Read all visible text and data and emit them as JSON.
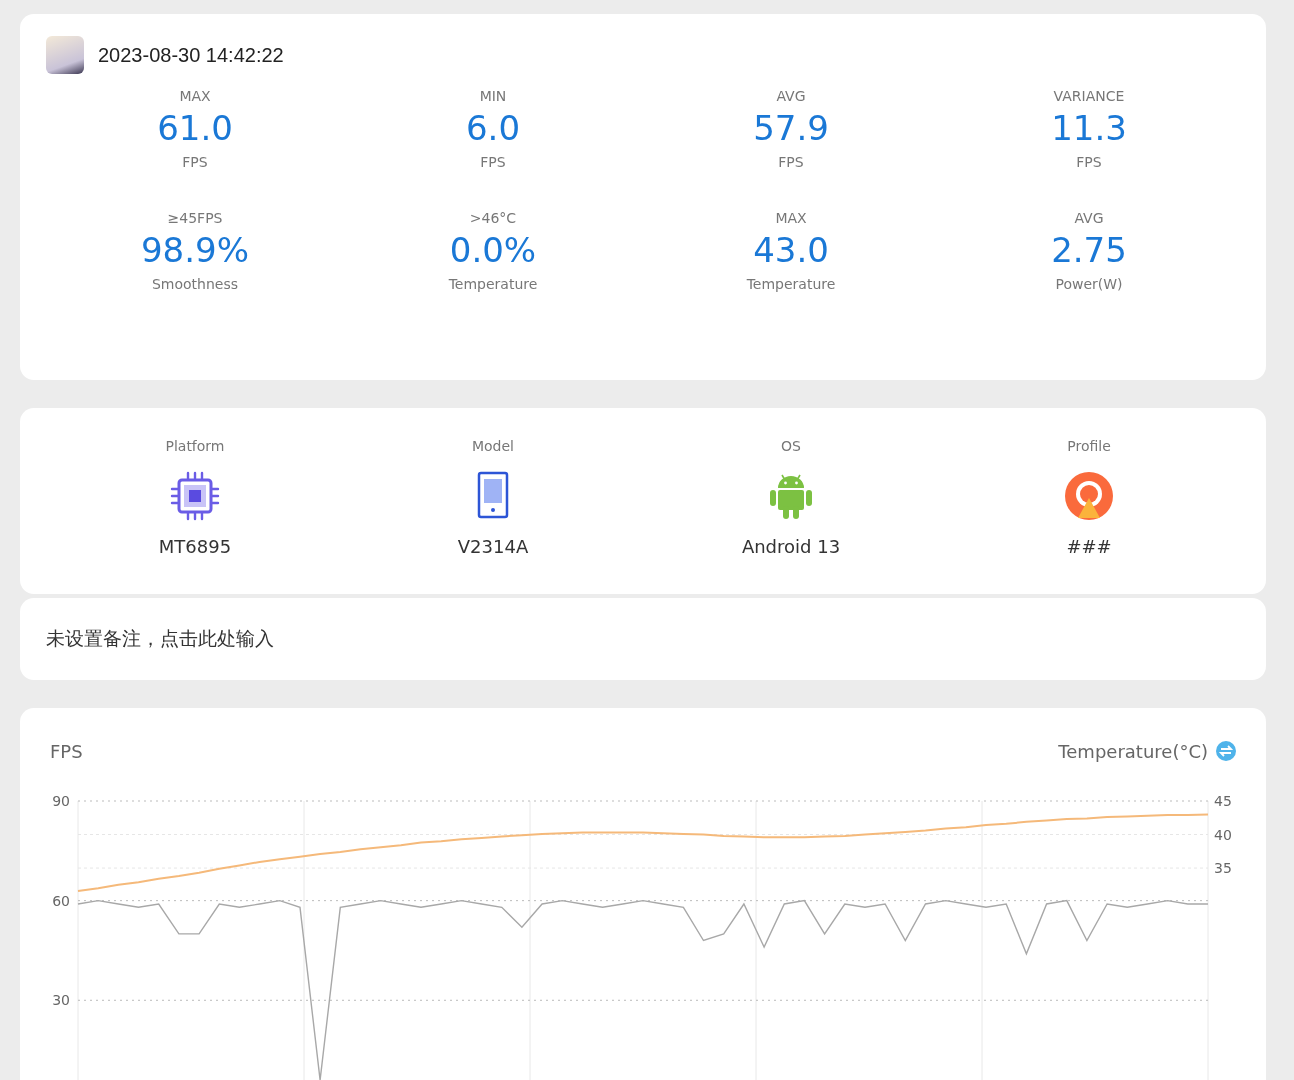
{
  "header": {
    "timestamp": "2023-08-30 14:42:22"
  },
  "stats": [
    {
      "label": "MAX",
      "value": "61.0",
      "unit": "FPS"
    },
    {
      "label": "MIN",
      "value": "6.0",
      "unit": "FPS"
    },
    {
      "label": "AVG",
      "value": "57.9",
      "unit": "FPS"
    },
    {
      "label": "VARIANCE",
      "value": "11.3",
      "unit": "FPS"
    },
    {
      "label": "≥45FPS",
      "value": "98.9%",
      "unit": "Smoothness"
    },
    {
      "label": ">46°C",
      "value": "0.0%",
      "unit": "Temperature"
    },
    {
      "label": "MAX",
      "value": "43.0",
      "unit": "Temperature"
    },
    {
      "label": "AVG",
      "value": "2.75",
      "unit": "Power(W)"
    }
  ],
  "device": [
    {
      "kind": "chip",
      "label": "Platform",
      "value": "MT6895"
    },
    {
      "kind": "phone",
      "label": "Model",
      "value": "V2314A"
    },
    {
      "kind": "android",
      "label": "OS",
      "value": "Android 13"
    },
    {
      "kind": "profile",
      "label": "Profile",
      "value": "###"
    }
  ],
  "note": {
    "text": "未设置备注，点击此处输入"
  },
  "chart": {
    "right_title": "Temperature(°C)",
    "chart_data": {
      "type": "line",
      "ylabel": "FPS",
      "ylim": [
        6,
        90
      ],
      "yticks": [
        90,
        60,
        30
      ],
      "y2lim": [
        3.4,
        45
      ],
      "y2ticks": [
        45,
        40,
        35
      ],
      "grid": true,
      "series": [
        {
          "color": "#a8a8a8",
          "values": [
            59,
            60,
            59,
            58,
            59,
            50,
            50,
            59,
            58,
            59,
            60,
            58,
            6,
            58,
            59,
            60,
            59,
            58,
            59,
            60,
            59,
            58,
            52,
            59,
            60,
            59,
            58,
            59,
            60,
            59,
            58,
            48,
            50,
            59,
            46,
            59,
            60,
            50,
            59,
            58,
            59,
            48,
            59,
            60,
            59,
            58,
            59,
            44,
            59,
            60,
            48,
            59,
            58,
            59,
            60,
            59,
            59
          ]
        },
        {
          "axis": "y2",
          "color": "#f5b97a",
          "values": [
            31.6,
            32.0,
            32.5,
            32.9,
            33.4,
            33.8,
            34.3,
            34.9,
            35.4,
            35.9,
            36.3,
            36.7,
            37.1,
            37.4,
            37.8,
            38.1,
            38.4,
            38.8,
            39.0,
            39.3,
            39.5,
            39.7,
            39.9,
            40.1,
            40.2,
            40.3,
            40.3,
            40.3,
            40.3,
            40.2,
            40.1,
            40.0,
            39.8,
            39.7,
            39.6,
            39.6,
            39.6,
            39.7,
            39.8,
            40.0,
            40.2,
            40.4,
            40.6,
            40.9,
            41.1,
            41.4,
            41.6,
            41.9,
            42.1,
            42.3,
            42.4,
            42.6,
            42.7,
            42.8,
            42.9,
            42.9,
            43.0
          ]
        }
      ]
    }
  }
}
